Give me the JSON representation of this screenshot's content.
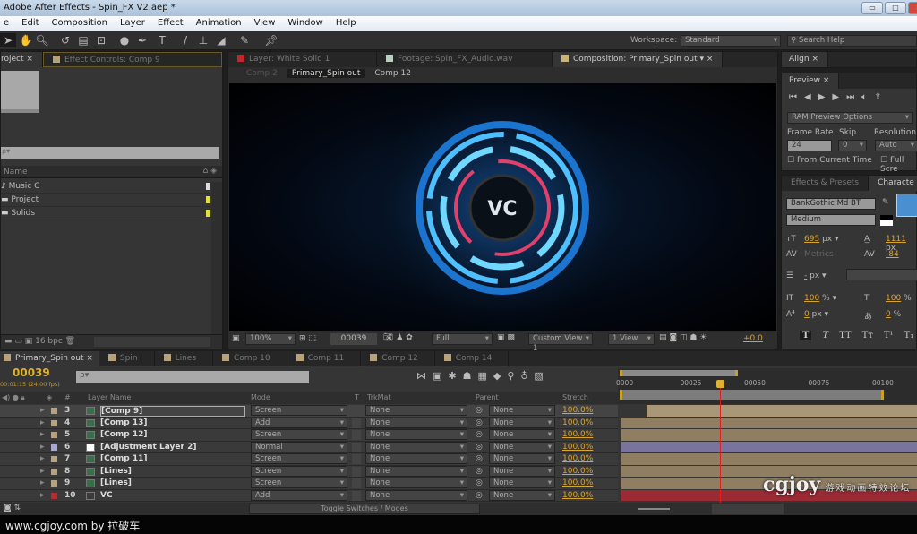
{
  "window": {
    "title": "Adobe After Effects - Spin_FX V2.aep *",
    "minimize": "▭",
    "maximize": "□",
    "close": "✕"
  },
  "menu": [
    "e",
    "Edit",
    "Composition",
    "Layer",
    "Effect",
    "Animation",
    "View",
    "Window",
    "Help"
  ],
  "toolbar": {
    "workspace_label": "Workspace:",
    "workspace_value": "Standard",
    "search_placeholder": "Search Help"
  },
  "project_panel": {
    "tabs": [
      "roject",
      "Effect Controls: Comp 9"
    ],
    "search_placeholder": "ρ▾",
    "column_name": "Name",
    "items": [
      {
        "name": "Music C",
        "icon": "audio-file-icon"
      },
      {
        "name": "Project",
        "icon": "folder-icon"
      },
      {
        "name": "Solids",
        "icon": "folder-icon"
      }
    ],
    "bpc": "16 bpc"
  },
  "viewer_panel": {
    "tabs": [
      "Layer: White Solid 1",
      "Footage: Spin_FX_Audio.wav",
      "Composition: Primary_Spin out"
    ],
    "breadcrumbs": [
      "Comp 2",
      "Primary_Spin out",
      "Comp 12"
    ],
    "logo_text": "VC",
    "zoom": "100%",
    "timecode": "00039",
    "resolution": "Full",
    "view": "Custom View 1",
    "view_count": "1 View",
    "exposure": "+0.0"
  },
  "right_panel": {
    "align_tab": "Align",
    "preview_tab": "Preview",
    "ram_preview": "RAM Preview Options",
    "frame_rate_label": "Frame Rate",
    "frame_rate": "24",
    "skip_label": "Skip",
    "skip": "0",
    "resolution_label": "Resolution",
    "resolution": "Auto",
    "from_current": "From Current Time",
    "full_screen": "Full Scre",
    "effects_tab": "Effects & Presets",
    "character_tab": "Characte",
    "font": "BankGothic Md BT",
    "style": "Medium",
    "font_size": "695",
    "font_size_unit": "px",
    "leading": "1111",
    "leading_unit": "px",
    "kerning": "Metrics",
    "tracking": "-84",
    "stroke": "-",
    "stroke_unit": "px",
    "vscale": "100",
    "hscale": "100",
    "baseline": "0",
    "baseline_unit": "px",
    "tsume": "0",
    "percent": "%",
    "fill_color": "#4a8fd0",
    "type_styles": [
      "T",
      "T",
      "TT",
      "Tт",
      "T¹",
      "T₁"
    ]
  },
  "timeline": {
    "tabs": [
      "Primary_Spin out",
      "Spin",
      "Lines",
      "Comp 10",
      "Comp 11",
      "Comp 12",
      "Comp 14"
    ],
    "timecode": "00039",
    "timecode_sub": "00:01:15 (24.00 fps)",
    "search_placeholder": "ρ▾",
    "headers": {
      "name": "Layer Name",
      "mode": "Mode",
      "t": "T",
      "trkmat": "TrkMat",
      "parent": "Parent",
      "stretch": "Stretch",
      "num": "#"
    },
    "ruler": [
      "0000",
      "00025",
      "00050",
      "00075",
      "00100"
    ],
    "current_frame": 39,
    "toggle_label": "Toggle Switches / Modes",
    "layers": [
      {
        "num": "3",
        "name": "[Comp 9]",
        "mode": "Screen",
        "trkmat": "None",
        "parent": "None",
        "stretch": "100.0%",
        "label": "#b8a27a",
        "bar": "#a89878",
        "selected": true
      },
      {
        "num": "4",
        "name": "[Comp 13]",
        "mode": "Add",
        "trkmat": "None",
        "parent": "None",
        "stretch": "100.0%",
        "label": "#b8a27a",
        "bar": "#8f7e62"
      },
      {
        "num": "5",
        "name": "[Comp 12]",
        "mode": "Screen",
        "trkmat": "None",
        "parent": "None",
        "stretch": "100.0%",
        "label": "#b8a27a",
        "bar": "#8f7e62"
      },
      {
        "num": "6",
        "name": "[Adjustment Layer 2]",
        "mode": "Normal",
        "trkmat": "None",
        "parent": "None",
        "stretch": "100.0%",
        "label": "#a8a8d8",
        "bar": "#78749e"
      },
      {
        "num": "7",
        "name": "[Comp 11]",
        "mode": "Screen",
        "trkmat": "None",
        "parent": "None",
        "stretch": "100.0%",
        "label": "#b8a27a",
        "bar": "#8f7e62"
      },
      {
        "num": "8",
        "name": "[Lines]",
        "mode": "Screen",
        "trkmat": "None",
        "parent": "None",
        "stretch": "100.0%",
        "label": "#b8a27a",
        "bar": "#8f7e62"
      },
      {
        "num": "9",
        "name": "[Lines]",
        "mode": "Screen",
        "trkmat": "None",
        "parent": "None",
        "stretch": "100.0%",
        "label": "#b8a27a",
        "bar": "#8f7e62"
      },
      {
        "num": "10",
        "name": "VC",
        "mode": "Add",
        "trkmat": "None",
        "parent": "None",
        "stretch": "100.0%",
        "label": "#c0282c",
        "bar": "#9a2a34"
      }
    ]
  },
  "watermark": {
    "footer": "www.cgjoy.com by 拉破车",
    "logo": "cgjoy",
    "logo_sub": "游戏动画特效论坛",
    "logo_url": "www.cgjoy.com"
  }
}
